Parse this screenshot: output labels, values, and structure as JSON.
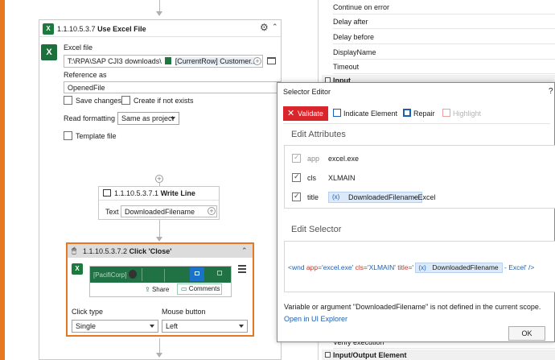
{
  "canvas": {
    "use_excel": {
      "id": "1.1.10.5.3.7",
      "title": "Use Excel File",
      "excel_file_label": "Excel file",
      "excel_file_path": "T:\\RPA\\SAP CJI3 downloads\\",
      "excel_file_var": "[CurrentRow] Customer...",
      "reference_label": "Reference as",
      "reference_value": "OpenedFile",
      "save_changes_label": "Save changes",
      "create_if_not_exists_label": "Create if not exists",
      "read_formatting_label": "Read formatting",
      "read_formatting_value": "Same as project",
      "template_file_label": "Template file",
      "icon": "gear-icon"
    },
    "write_line": {
      "id": "1.1.10.5.3.7.1",
      "title": "Write Line",
      "text_label": "Text",
      "text_value": "DownloadedFilename"
    },
    "click_close": {
      "id": "1.1.10.5.3.7.2",
      "title": "Click 'Close'",
      "preview_org": "[PacifiCorp]",
      "preview_share": "Share",
      "preview_comments": "Comments",
      "click_type_label": "Click type",
      "click_type_value": "Single",
      "mouse_button_label": "Mouse button",
      "mouse_button_value": "Left"
    }
  },
  "properties": {
    "rows": [
      "Continue on error",
      "Delay after",
      "Delay before",
      "DisplayName",
      "Timeout"
    ],
    "group_input": "Input",
    "row_verify": "Verify execution",
    "group_input_output": "Input/Output Element"
  },
  "selector_editor": {
    "title": "Selector Editor",
    "help": "?",
    "validate_label": "Validate",
    "indicate_label": "Indicate Element",
    "repair_label": "Repair",
    "highlight_label": "Highlight",
    "edit_attributes_head": "Edit Attributes",
    "attributes": [
      {
        "name": "app",
        "value": "excel.exe",
        "checked": true,
        "disabled": true
      },
      {
        "name": "cls",
        "value": "XLMAIN",
        "checked": true,
        "disabled": false
      },
      {
        "name": "title",
        "var": "DownloadedFilename",
        "suffix": "- Excel",
        "checked": true,
        "disabled": false
      }
    ],
    "edit_selector_head": "Edit Selector",
    "selector_prefix": "<wnd ",
    "selector_app_attr": "app=",
    "selector_app_val": "'excel.exe'",
    "selector_cls_attr": " cls=",
    "selector_cls_val": "'XLMAIN'",
    "selector_title_attr": " title=",
    "selector_title_open": "'",
    "selector_var": "DownloadedFilename",
    "selector_suffix": "- Excel'",
    "selector_close": " />",
    "error_message": "Variable or argument \"DownloadedFilename\" is not defined in the current scope.",
    "open_ui_explorer": "Open in UI Explorer",
    "ok_label": "OK"
  },
  "colors": {
    "accent_orange": "#e87722",
    "excel_green": "#1d6f3b",
    "validate_red": "#d9262c",
    "link_blue": "#1a5fb4",
    "selector_attr_red": "#c0392b"
  }
}
